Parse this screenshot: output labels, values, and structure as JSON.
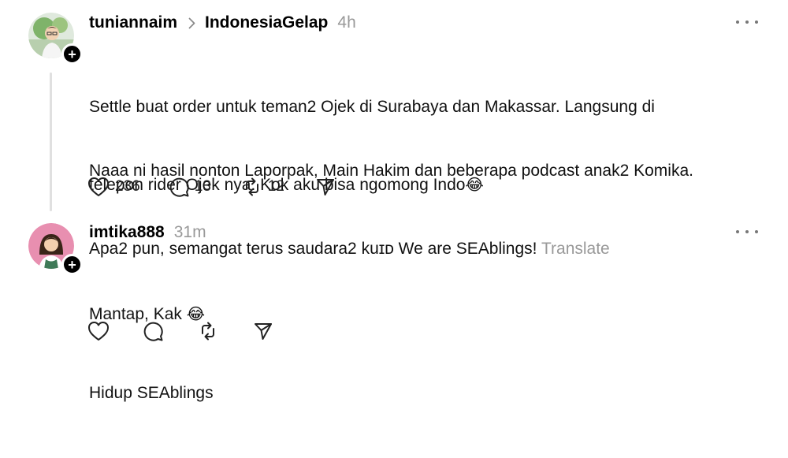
{
  "post1": {
    "username": "tuniannaim",
    "community": "IndonesiaGelap",
    "time": "4h",
    "paragraph1_line1": "Settle buat order untuk teman2 Ojek di Surabaya dan Makassar. Langsung di",
    "paragraph1_line2": "telepon rider Ojek nya. Kok aku bisa ngomong Indo",
    "paragraph1_emoji": "😂",
    "paragraph2_line1": "Naaa ni hasil nonton Laporpak, Main Hakim dan beberapa podcast anak2 Komika.",
    "paragraph2_line2": "Apa2 pun, semangat terus saudara2 kuɪᴅ We are SEAblings!",
    "translate_label": "Translate",
    "likes": "236",
    "comments": "13",
    "reposts": "12"
  },
  "post2": {
    "username": "imtika888",
    "time": "31m",
    "line1": "Mantap, Kak",
    "line1_emoji": "😂",
    "line2": "Hidup SEAblings"
  },
  "icons": {
    "like": "heart-icon",
    "comment": "comment-icon",
    "repost": "repost-icon",
    "share": "send-icon",
    "more": "more-icon",
    "follow": "plus-icon"
  }
}
